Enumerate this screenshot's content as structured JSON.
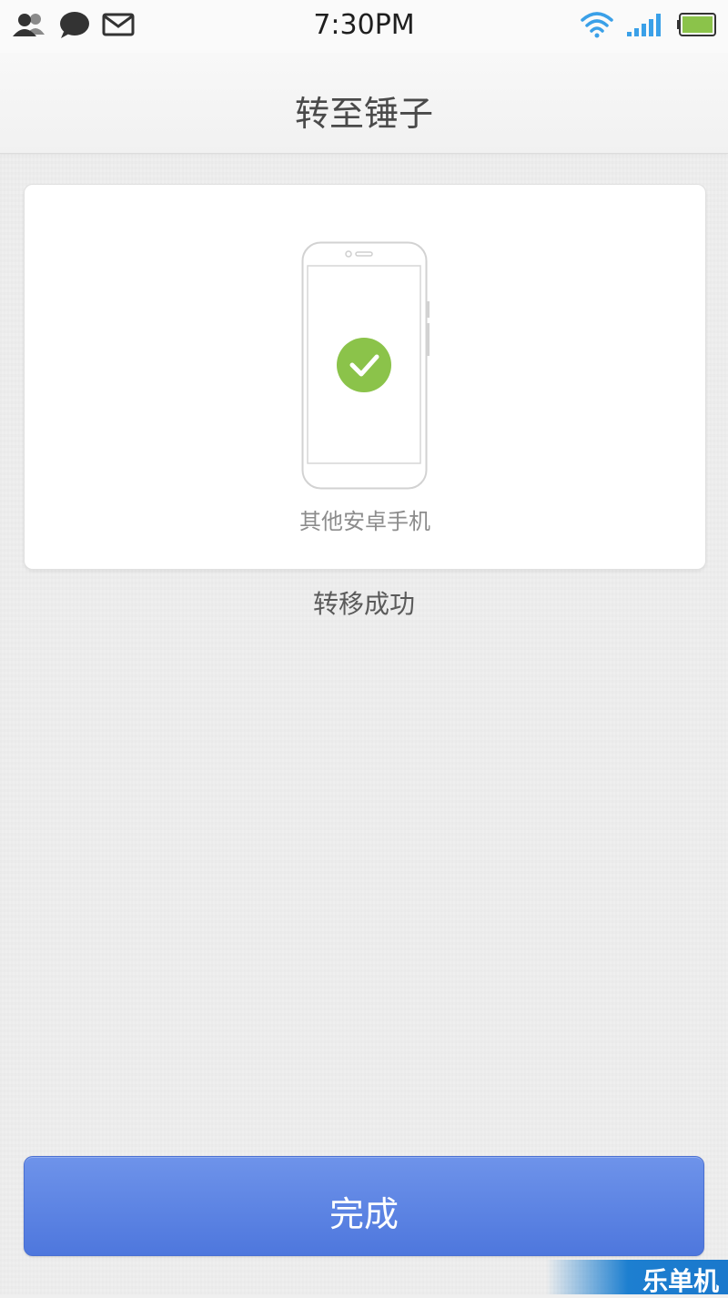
{
  "status_bar": {
    "time": "7:30PM",
    "left_icons": [
      "contacts-icon",
      "chat-bubble-icon",
      "mail-icon"
    ],
    "right_icons": [
      "wifi-icon",
      "signal-icon",
      "battery-icon"
    ]
  },
  "header": {
    "title": "转至锤子"
  },
  "card": {
    "device_label": "其他安卓手机",
    "icon": "phone-check-icon",
    "check_color": "#8bc34a"
  },
  "status_message": "转移成功",
  "done_button": {
    "label": "完成",
    "color": "#5b82e2"
  },
  "watermark": {
    "text": "乐单机"
  }
}
